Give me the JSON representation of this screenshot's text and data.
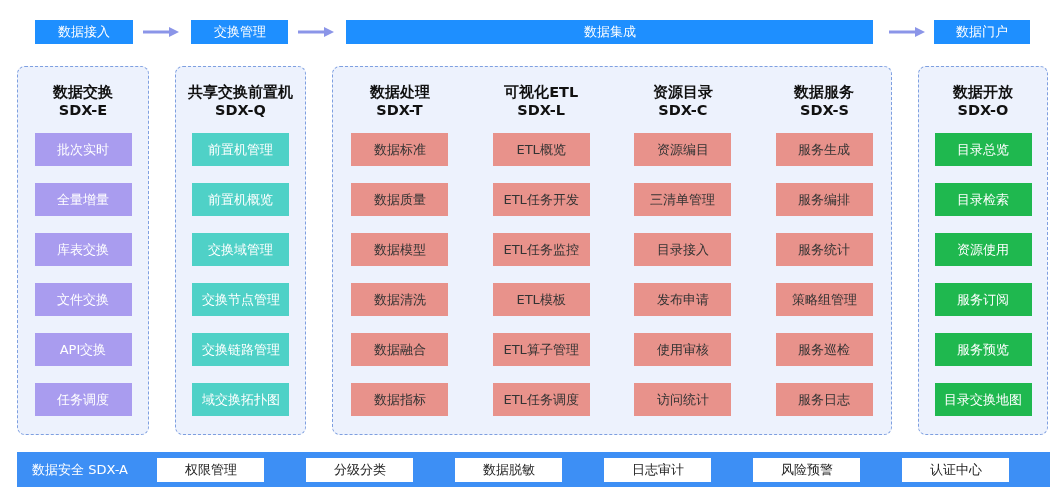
{
  "stages": [
    {
      "label": "数据接入"
    },
    {
      "label": "交换管理"
    },
    {
      "label": "数据集成"
    },
    {
      "label": "数据门户"
    }
  ],
  "panels": [
    {
      "groups": [
        {
          "title": "数据交换",
          "code": "SDX-E",
          "kind": "purple",
          "items": [
            "批次实时",
            "全量增量",
            "库表交换",
            "文件交换",
            "API交换",
            "任务调度"
          ]
        }
      ]
    },
    {
      "groups": [
        {
          "title": "共享交换前置机",
          "code": "SDX-Q",
          "kind": "teal",
          "items": [
            "前置机管理",
            "前置机概览",
            "交换域管理",
            "交换节点管理",
            "交换链路管理",
            "域交换拓扑图"
          ]
        }
      ]
    },
    {
      "groups": [
        {
          "title": "数据处理",
          "code": "SDX-T",
          "kind": "salmon",
          "items": [
            "数据标准",
            "数据质量",
            "数据模型",
            "数据清洗",
            "数据融合",
            "数据指标"
          ]
        },
        {
          "title": "可视化ETL",
          "code": "SDX-L",
          "kind": "salmon",
          "items": [
            "ETL概览",
            "ETL任务开发",
            "ETL任务监控",
            "ETL模板",
            "ETL算子管理",
            "ETL任务调度"
          ]
        },
        {
          "title": "资源目录",
          "code": "SDX-C",
          "kind": "salmon",
          "items": [
            "资源编目",
            "三清单管理",
            "目录接入",
            "发布申请",
            "使用审核",
            "访问统计"
          ]
        },
        {
          "title": "数据服务",
          "code": "SDX-S",
          "kind": "salmon",
          "items": [
            "服务生成",
            "服务编排",
            "服务统计",
            "策略组管理",
            "服务巡检",
            "服务日志"
          ]
        }
      ]
    },
    {
      "groups": [
        {
          "title": "数据开放",
          "code": "SDX-O",
          "kind": "green",
          "items": [
            "目录总览",
            "目录检索",
            "资源使用",
            "服务订阅",
            "服务预览",
            "目录交换地图"
          ]
        }
      ]
    }
  ],
  "security": {
    "label": "数据安全 SDX-A",
    "items": [
      "权限管理",
      "分级分类",
      "数据脱敏",
      "日志审计",
      "风险预警",
      "认证中心"
    ]
  }
}
